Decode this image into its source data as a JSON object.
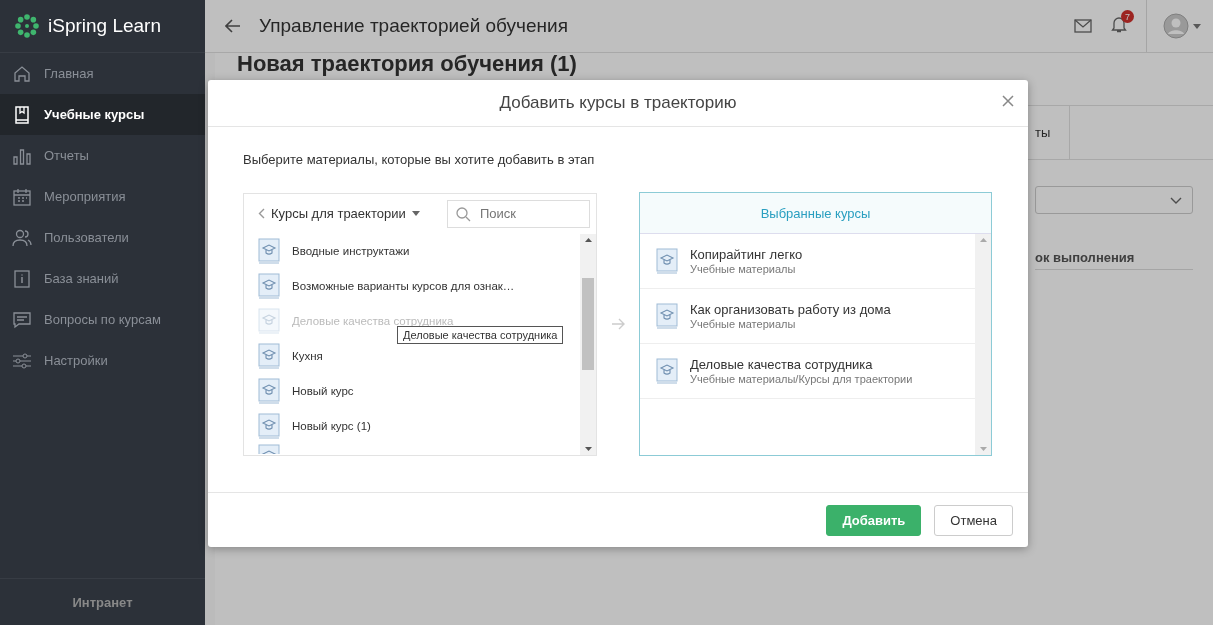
{
  "sidebar": {
    "logo": "iSpring Learn",
    "items": [
      {
        "label": "Главная",
        "selected": false
      },
      {
        "label": "Учебные курсы",
        "selected": true
      },
      {
        "label": "Отчеты",
        "selected": false
      },
      {
        "label": "Мероприятия",
        "selected": false
      },
      {
        "label": "Пользователи",
        "selected": false
      },
      {
        "label": "База знаний",
        "selected": false
      },
      {
        "label": "Вопросы по курсам",
        "selected": false
      },
      {
        "label": "Настройки",
        "selected": false
      }
    ],
    "footer": "Интранет"
  },
  "header": {
    "title": "Управление траекторией обучения",
    "notification_count": "7"
  },
  "page": {
    "title": "Новая траектория обучения (1)",
    "tab_fragment": "ты",
    "column_fragment": "ок выполнения"
  },
  "dialog": {
    "title": "Добавить курсы в траекторию",
    "instruction": "Выберите материалы, которые вы хотите добавить в этап",
    "folder": "Курсы для траектории",
    "search": {
      "placeholder": "Поиск"
    },
    "courses": [
      {
        "name": "Вводные инструктажи",
        "disabled": false
      },
      {
        "name": "Возможные варианты курсов для ознак…",
        "disabled": false
      },
      {
        "name": "Деловые качества сотрудника",
        "disabled": true
      },
      {
        "name": "Кухня",
        "disabled": false
      },
      {
        "name": "Новый курс",
        "disabled": false
      },
      {
        "name": "Новый курс (1)",
        "disabled": false
      }
    ],
    "tooltip": "Деловые качества сотрудника",
    "selected_panel": {
      "title": "Выбранные курсы",
      "items": [
        {
          "name": "Копирайтинг легко",
          "path": "Учебные материалы"
        },
        {
          "name": "Как организовать работу из дома",
          "path": "Учебные материалы"
        },
        {
          "name": "Деловые качества сотрудника",
          "path": "Учебные материалы/Курсы для траектории"
        }
      ]
    },
    "buttons": [
      {
        "label": "Добавить",
        "kind": "primary"
      },
      {
        "label": "Отмена",
        "kind": "secondary"
      }
    ]
  }
}
